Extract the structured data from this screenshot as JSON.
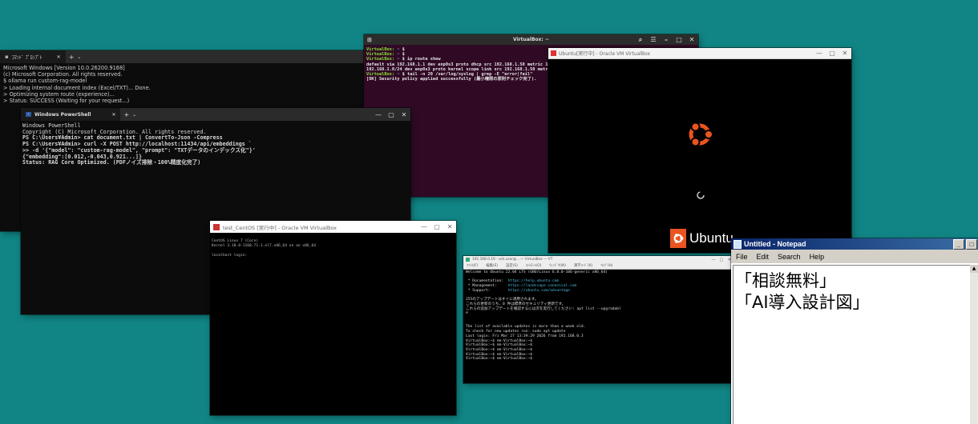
{
  "cmd": {
    "tab_title": "ｺﾏﾝﾄﾞ ﾌﾟﾛﾝﾌﾟﾄ",
    "new_tab": "+",
    "lines": [
      "Microsoft Windows [Version 10.0.26200.9168]",
      "(c) Microsoft Corporation. All rights reserved.",
      "$ ollama run custom-rag-model",
      "> Loading internal document index (Excel/TXT)... Done.",
      "> Optimizing system route (experience)...",
      "> Status: SUCCESS (Waiting for your request...)"
    ]
  },
  "powershell": {
    "tab_title": "Windows PowerShell",
    "new_tab": "+",
    "lines": [
      "Windows PowerShell",
      "Copyright (C) Microsoft Corporation. All rights reserved.",
      "PS C:\\Users¥Admin> cat document.txt | ConvertTo-Json -Compress",
      "PS C:\\Users¥Admin> curl -X POST http://localhost:11434/api/embeddings `",
      ">> -d '{\"model\": \"custom-rag-model\", \"prompt\": \"TXTデータのインデックス化\"}'",
      "{\"embedding\":[0.012,-0.043,0.921...]}",
      "Status: RAG Core Optimized. (PDFノイズ排除・100%精度化完了)"
    ]
  },
  "ubuntu_terminal": {
    "title": "VirtualBox: ~",
    "prompt_user": "VirtualBox:",
    "prompt_path": " ~",
    "cmd1": " $",
    "cmd2": " $",
    "cmd3": " $ ip route show",
    "out1": "default via 192.168.1.1 dev enp0s3 proto dhcp src 192.168.1.50 metric 100",
    "out2": "192.168.1.0/24 dev enp0s3 proto kernel scope link src 192.168.1.50 metric 100",
    "cmd4": " $ tail -n 20 /var/log/syslog | grep -E \"error|fail\"",
    "out3": "[OK] Security policy applied successfully (最小権限の原則チェック完了)."
  },
  "ubuntu_vm": {
    "title": "Ubuntu[実行中] - Oracle VM VirtualBox",
    "brand": "Ubuntu"
  },
  "centos_vm": {
    "title": "test_CentOS [実行中] - Oracle VM VirtualBox",
    "lines": [
      "CentOS Linux 7 (Core)",
      "Kernel 3.10.0-1160.71.1.el7.x86_64 on an x86_64",
      "",
      "localhost login:"
    ]
  },
  "ssh": {
    "title": "192.168.0.19 - ssh.user@...:~ VirtualBox — VT",
    "menu": [
      "ﾌｧｲﾙ(F)",
      "編集(E)",
      "設定(S)",
      "ｺﾝﾄﾛｰﾙ(O)",
      "ｳｨﾝﾄﾞｳ(W)",
      "漢字ｺｰﾄﾞ(K)",
      "ﾍﾙﾌﾟ(H)"
    ],
    "welcome": "Welcome to Ubuntu 22.04 LTS (GNU/Linux 6.8.0-106-generic x86_64)",
    "doc_label": " * Documentation:  ",
    "doc_url": "https://help.ubuntu.com",
    "mgmt_label": " * Management:     ",
    "mgmt_url": "https://landscape.canonical.com",
    "support_label": " * Support:        ",
    "support_url": "https://ubuntu.com/advantage",
    "rest": "\n255のアップデートはすぐに適用されます。\nこれらの更新のうち、0 件は標準のセキュリティ更新です。\nこれらの追加アップデートを確認するには次を実行してください: apt list --upgradabl\ne\n\n\nThe list of available updates is more than a week old.\nTo check for new updates run: sudo apt update\nLast login: Fri Mar 27 13:39:29 2026 from 192.168.0.3\nVirtualBox:~$ nm-VirtualBox:~$\nVirtualBox:~$ nm-VirtualBox:~$\nVirtualBox:~$ nm-VirtualBox:~$\nVirtualBox:~$ nm-VirtualBox:~$\nVirtualBox:~$ nm-VirtualBox:~$"
  },
  "notepad": {
    "title": "Untitled - Notepad",
    "menu": [
      "File",
      "Edit",
      "Search",
      "Help"
    ],
    "line1": "「相談無料」",
    "line2": "「AI導入設計図」"
  }
}
